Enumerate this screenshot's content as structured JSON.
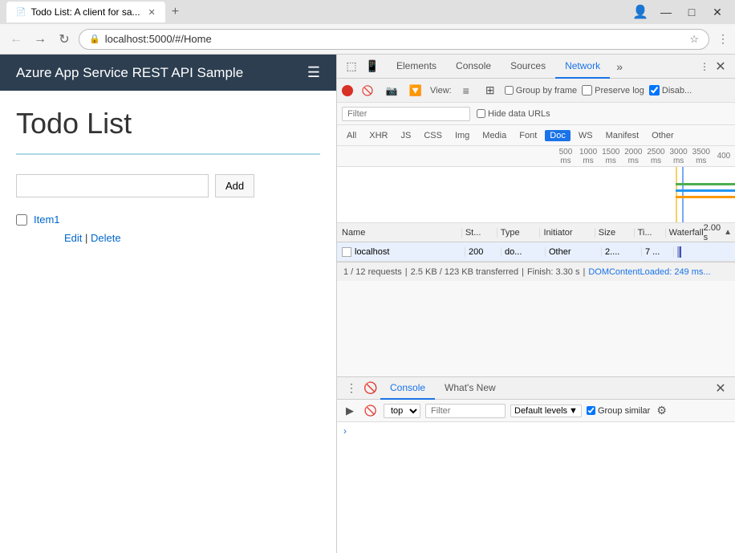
{
  "browser": {
    "tab_title": "Todo List: A client for sa...",
    "url": "localhost:5000/#/Home",
    "win_controls": {
      "minimize": "—",
      "maximize": "□",
      "close": "✕"
    }
  },
  "webpage": {
    "header_title": "Azure App Service REST API Sample",
    "page_title": "Todo List",
    "add_input_placeholder": "",
    "add_button": "Add",
    "todo_item": "Item1",
    "todo_edit": "Edit",
    "todo_delete": "Delete"
  },
  "devtools": {
    "tabs": [
      "Elements",
      "Console",
      "Sources",
      "Network"
    ],
    "active_tab": "Network",
    "filter_placeholder": "Filter",
    "hide_data_urls": "Hide data URLs",
    "type_filters": [
      "All",
      "XHR",
      "JS",
      "CSS",
      "Img",
      "Media",
      "Font",
      "Doc",
      "WS",
      "Manifest",
      "Other"
    ],
    "active_type": "Doc",
    "group_by_frame": "Group by frame",
    "preserve_log": "Preserve log",
    "disable_cache": "Disab...",
    "timeline_labels": [
      "500 ms",
      "1000 ms",
      "1500 ms",
      "2000 ms",
      "2500 ms",
      "3000 ms",
      "3500 ms",
      "400"
    ],
    "table_headers": {
      "name": "Name",
      "status": "St...",
      "type": "Type",
      "initiator": "Initiator",
      "size": "Size",
      "time": "Ti...",
      "waterfall": "Waterfall",
      "waterfall_time": "2.00 s"
    },
    "network_row": {
      "name": "localhost",
      "status": "200",
      "type": "do...",
      "initiator": "Other",
      "size": "2....",
      "time": "7 ..."
    },
    "status_bar": {
      "requests": "1 / 12 requests",
      "transferred": "2.5 KB / 123 KB transferred",
      "finish": "Finish: 3.30 s",
      "dom_content": "DOMContentLoaded: 249 ms..."
    }
  },
  "console": {
    "tabs": [
      "Console",
      "What's New"
    ],
    "active_tab": "Console",
    "context": "top",
    "filter_placeholder": "Filter",
    "default_levels": "Default levels",
    "group_similar": "Group similar",
    "settings_icon": "⚙"
  }
}
